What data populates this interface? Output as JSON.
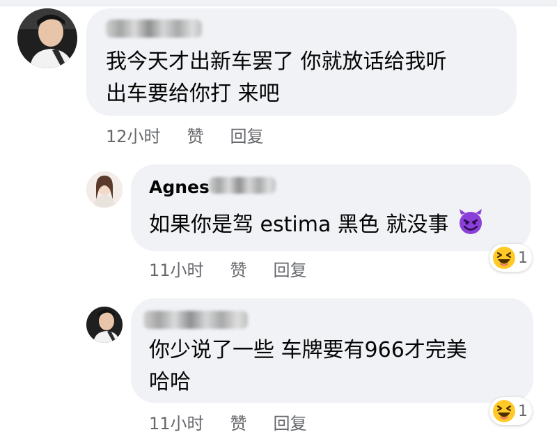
{
  "comments": [
    {
      "text_line1": "我今天才出新车罢了 你就放话给我听",
      "text_line2": "出车要给你打 来吧",
      "time": "12小时",
      "like_label": "赞",
      "reply_label": "回复"
    },
    {
      "author": "Agnes",
      "text": "如果你是驾 estima 黑色 就没事",
      "emoji_icon": "smiling-devil-icon",
      "time": "11小时",
      "like_label": "赞",
      "reply_label": "回复",
      "reaction_icon": "laughing-squint-icon",
      "reaction_count": "1"
    },
    {
      "text_line1": "你少说了一些 车牌要有966才完美",
      "text_line2": "哈哈",
      "time": "11小时",
      "like_label": "赞",
      "reply_label": "回复",
      "reaction_icon": "laughing-squint-icon",
      "reaction_count": "1"
    }
  ],
  "colors": {
    "bubble": "#f0f2f5",
    "meta_text": "#65676b",
    "devil_purple": "#8b3fd9",
    "emoji_yellow": "#ffc928"
  }
}
